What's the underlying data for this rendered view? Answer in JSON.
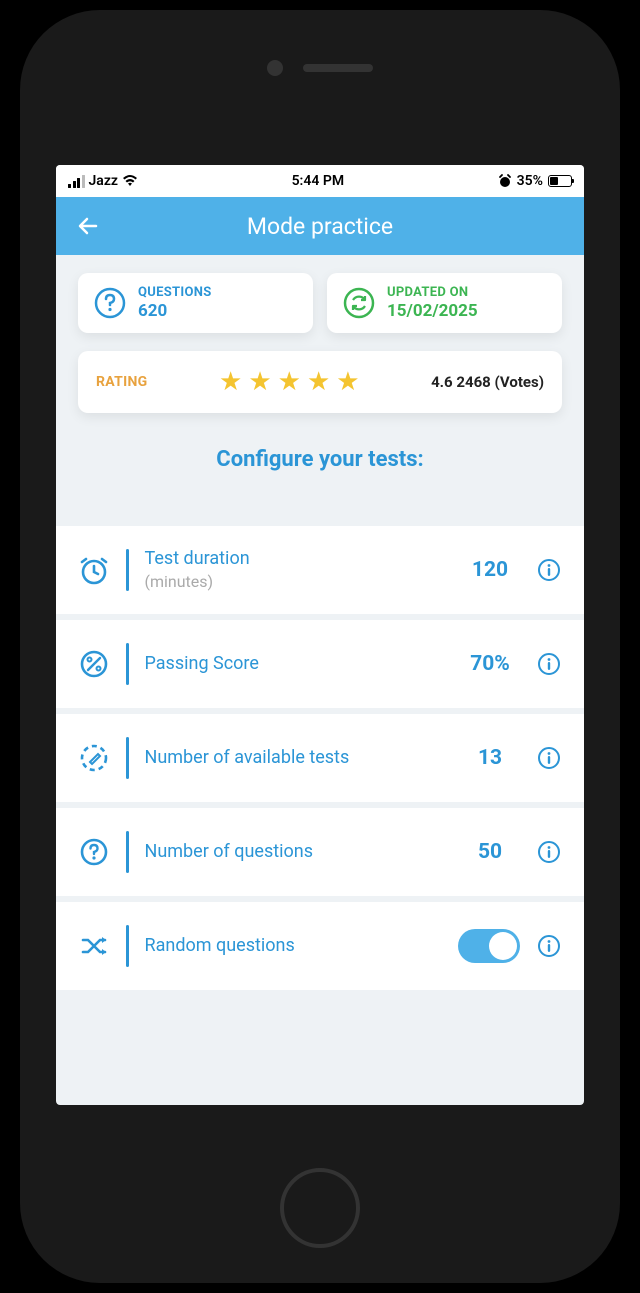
{
  "status": {
    "carrier": "Jazz",
    "time": "5:44 PM",
    "battery_pct": "35%",
    "battery_fill_width": "8"
  },
  "header": {
    "title": "Mode practice"
  },
  "cards": {
    "questions": {
      "label": "QUESTIONS",
      "value": "620"
    },
    "updated": {
      "label": "UPDATED ON",
      "value": "15/02/2025"
    }
  },
  "rating": {
    "label": "RATING",
    "text": "4.6 2468 (Votes)"
  },
  "configure_heading": "Configure your tests:",
  "rows": {
    "duration": {
      "label": "Test duration",
      "sublabel": "(minutes)",
      "value": "120"
    },
    "passing": {
      "label": "Passing Score",
      "value": "70%"
    },
    "tests": {
      "label": "Number of available tests",
      "value": "13"
    },
    "questions": {
      "label": "Number of questions",
      "value": "50"
    },
    "random": {
      "label": "Random questions",
      "enabled": true
    }
  }
}
